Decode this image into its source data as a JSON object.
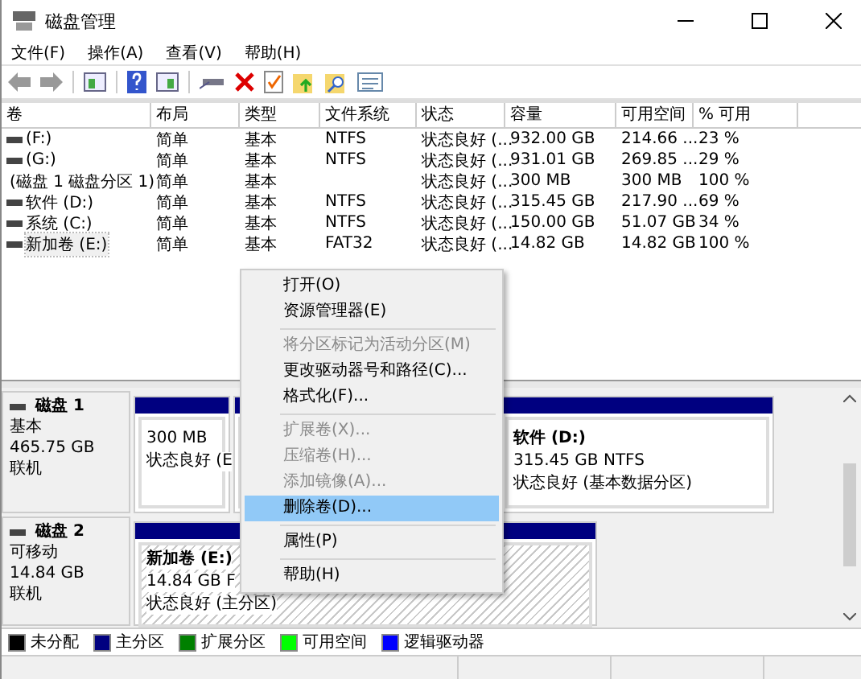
{
  "window": {
    "title": "磁盘管理"
  },
  "menu_bar": [
    "文件(F)",
    "操作(A)",
    "查看(V)",
    "帮助(H)"
  ],
  "table": {
    "columns": [
      "卷",
      "布局",
      "类型",
      "文件系统",
      "状态",
      "容量",
      "可用空间",
      "% 可用"
    ],
    "rows": [
      {
        "cells": [
          " (F:)",
          "简单",
          "基本",
          "NTFS",
          "状态良好 (...",
          "932.00 GB",
          "214.66 ...",
          "23 %"
        ],
        "selected": false
      },
      {
        "cells": [
          " (G:)",
          "简单",
          "基本",
          "NTFS",
          "状态良好 (...",
          "931.01 GB",
          "269.85 ...",
          "29 %"
        ],
        "selected": false
      },
      {
        "cells": [
          "(磁盘 1 磁盘分区 1)",
          "简单",
          "基本",
          "",
          "状态良好 (...",
          "300 MB",
          "300 MB",
          "100 %"
        ],
        "selected": false
      },
      {
        "cells": [
          "软件 (D:)",
          "简单",
          "基本",
          "NTFS",
          "状态良好 (...",
          "315.45 GB",
          "217.90 ...",
          "69 %"
        ],
        "selected": false
      },
      {
        "cells": [
          "系统 (C:)",
          "简单",
          "基本",
          "NTFS",
          "状态良好 (...",
          "150.00 GB",
          "51.07 GB",
          "34 %"
        ],
        "selected": false
      },
      {
        "cells": [
          "新加卷 (E:)",
          "简单",
          "基本",
          "FAT32",
          "状态良好 (...",
          "14.82 GB",
          "14.82 GB",
          "100 %"
        ],
        "selected": true
      }
    ]
  },
  "disks": [
    {
      "name": "磁盘 1",
      "type": "基本",
      "size": "465.75 GB",
      "status": "联机",
      "partitions": [
        {
          "kind": "primary",
          "lines": [
            "300 MB",
            "状态良好 (E"
          ],
          "selected": false
        },
        {
          "kind": "primary"
        },
        {
          "kind": "primary",
          "title": "软件 (D:)",
          "lines": [
            "315.45 GB NTFS",
            "状态良好 (基本数据分区)"
          ],
          "selected": false
        }
      ]
    },
    {
      "name": "磁盘 2",
      "type": "可移动",
      "size": "14.84 GB",
      "status": "联机",
      "partitions": [
        {
          "kind": "primary",
          "title": "新加卷 (E:)",
          "lines": [
            "14.84 GB F",
            "状态良好 (主分区)"
          ],
          "selected": true
        }
      ]
    }
  ],
  "legend": [
    {
      "label": "未分配",
      "color": "#000000"
    },
    {
      "label": "主分区",
      "color": "#000080"
    },
    {
      "label": "扩展分区",
      "color": "#008000"
    },
    {
      "label": "可用空间",
      "color": "#00ff00"
    },
    {
      "label": "逻辑驱动器",
      "color": "#0000ff"
    }
  ],
  "context_menu": [
    {
      "kind": "item",
      "label": "打开(O)",
      "disabled": false,
      "selected": false
    },
    {
      "kind": "item",
      "label": "资源管理器(E)",
      "disabled": false,
      "selected": false
    },
    {
      "kind": "separator"
    },
    {
      "kind": "item",
      "label": "将分区标记为活动分区(M)",
      "disabled": true,
      "selected": false
    },
    {
      "kind": "item",
      "label": "更改驱动器号和路径(C)...",
      "disabled": false,
      "selected": false
    },
    {
      "kind": "item",
      "label": "格式化(F)...",
      "disabled": false,
      "selected": false
    },
    {
      "kind": "separator"
    },
    {
      "kind": "item",
      "label": "扩展卷(X)...",
      "disabled": true,
      "selected": false
    },
    {
      "kind": "item",
      "label": "压缩卷(H)...",
      "disabled": true,
      "selected": false
    },
    {
      "kind": "item",
      "label": "添加镜像(A)...",
      "disabled": true,
      "selected": false
    },
    {
      "kind": "item",
      "label": "删除卷(D)...",
      "disabled": false,
      "selected": true
    },
    {
      "kind": "separator"
    },
    {
      "kind": "item",
      "label": "属性(P)",
      "disabled": false,
      "selected": false
    },
    {
      "kind": "separator"
    },
    {
      "kind": "item",
      "label": "帮助(H)",
      "disabled": false,
      "selected": false
    }
  ]
}
